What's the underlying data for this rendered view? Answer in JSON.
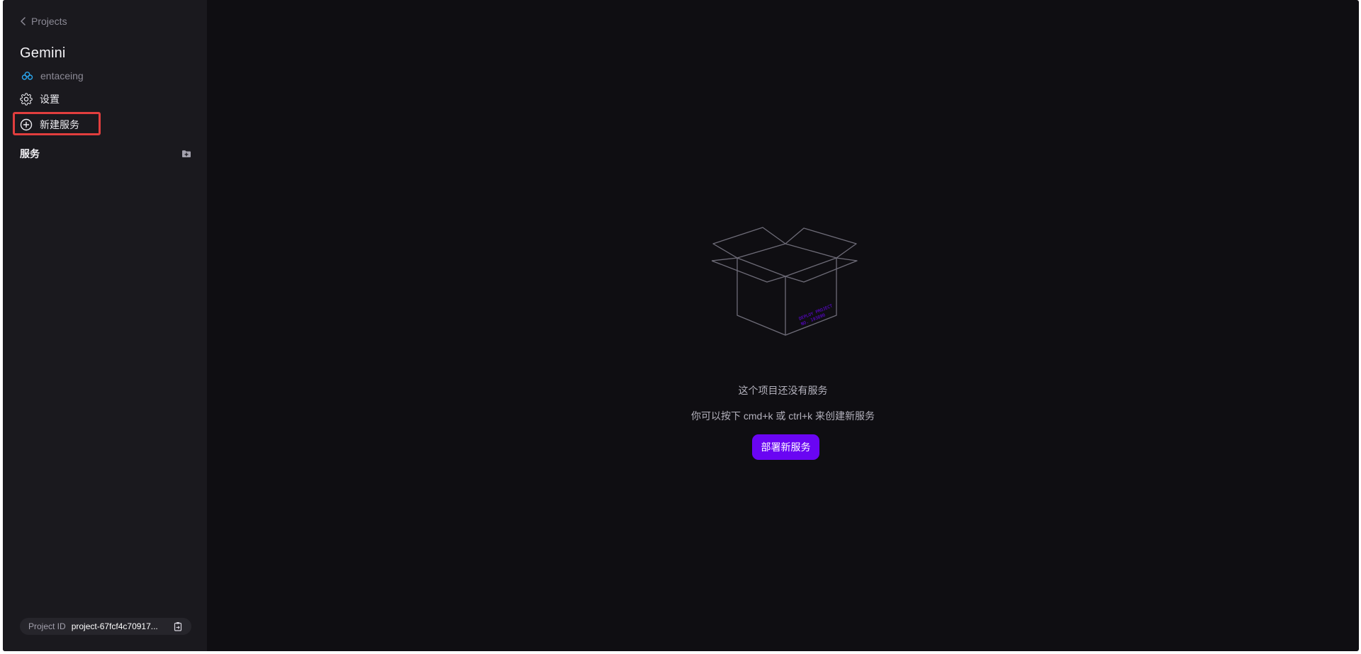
{
  "sidebar": {
    "back_label": "Projects",
    "project_name": "Gemini",
    "workspace_name": "entaceing",
    "nav": {
      "settings_label": "设置",
      "new_service_label": "新建服务"
    },
    "services_header": "服务",
    "project_id": {
      "label": "Project ID",
      "value": "project-67fcf4c70917..."
    }
  },
  "main": {
    "empty_title": "这个项目还没有服务",
    "empty_hint": "你可以按下 cmd+k 或 ctrl+k 来创建新服务",
    "deploy_button_label": "部署新服务",
    "box_stamp": [
      "DEPLOY PROJECT",
      "NO. 193890"
    ]
  },
  "colors": {
    "accent": "#6a05f3",
    "highlight": "#e23e3e",
    "sidebar_bg": "#1a191e",
    "main_bg": "#0f0e12"
  },
  "icons": {
    "back": "chevron-left-icon",
    "workspace": "cloud-team-icon",
    "settings": "gear-icon",
    "new_service": "plus-circle-icon",
    "new_folder": "folder-plus-icon",
    "copy": "clipboard-copy-icon"
  }
}
